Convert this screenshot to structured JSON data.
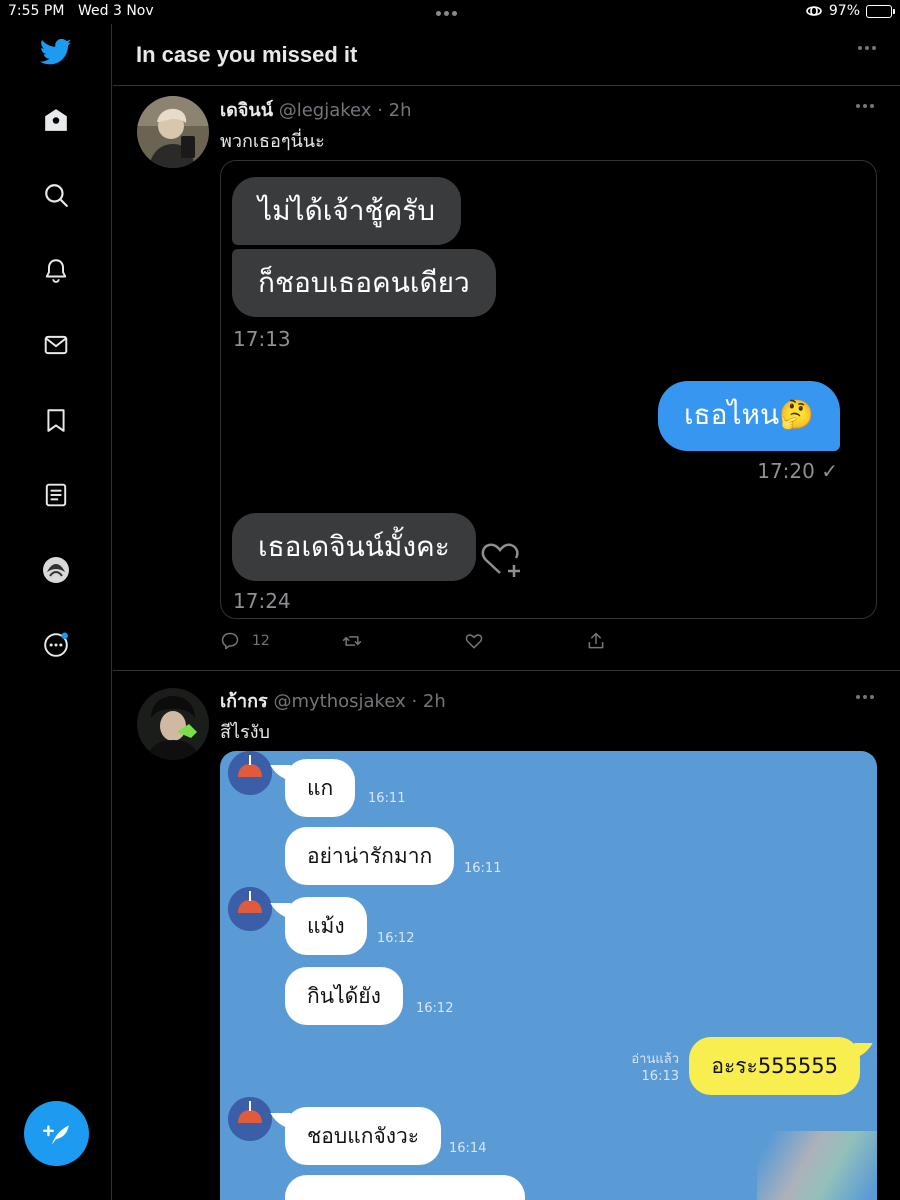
{
  "status_bar": {
    "time": "7:55 PM",
    "date": "Wed 3 Nov",
    "battery": "97%"
  },
  "sidebar": {
    "items": [
      {
        "icon": "twitter-logo-icon"
      },
      {
        "icon": "home-icon"
      },
      {
        "icon": "search-icon"
      },
      {
        "icon": "bell-icon"
      },
      {
        "icon": "mail-icon"
      },
      {
        "icon": "bookmark-icon"
      },
      {
        "icon": "lists-icon"
      },
      {
        "icon": "profile-avatar-icon"
      },
      {
        "icon": "more-icon"
      }
    ],
    "compose_icon": "compose-quill-icon"
  },
  "header": {
    "title": "In case you missed it"
  },
  "tweets": [
    {
      "name": "เดจินน์",
      "handle": "@legjakex",
      "time": "· 2h",
      "text": "พวกเธอๆนี่นะ",
      "chat": {
        "b1": "ไม่ได้เจ้าชู้ครับ",
        "b2": "ก็ชอบเธอคนเดียว",
        "t1": "17:13",
        "b3": "เธอไหน🤔",
        "t2": "17:20 ✓",
        "b4": "เธอเดจินน์มั้งคะ",
        "t3": "17:24"
      },
      "replies": "12"
    },
    {
      "name": "เก้ากร",
      "handle": "@mythosjakex",
      "time": "· 2h",
      "text": "สีไรงับ",
      "line_chat": {
        "m1": "แก",
        "t1": "16:11",
        "m2": "อย่าน่ารักมาก",
        "t2": "16:11",
        "m3": "แม้ง",
        "t3": "16:12",
        "m4": "กินได้ยัง",
        "t4": "16:12",
        "read_label": "อ่านแล้ว",
        "t5": "16:13",
        "m5": "อะระ555555",
        "m6": "ชอบแกจังวะ",
        "t6": "16:14"
      }
    }
  ],
  "colors": {
    "accent": "#1d9bf0",
    "line_bg": "#5b9bd5",
    "bubble_blue": "#3797f0",
    "bubble_yellow": "#f8ee4f"
  }
}
